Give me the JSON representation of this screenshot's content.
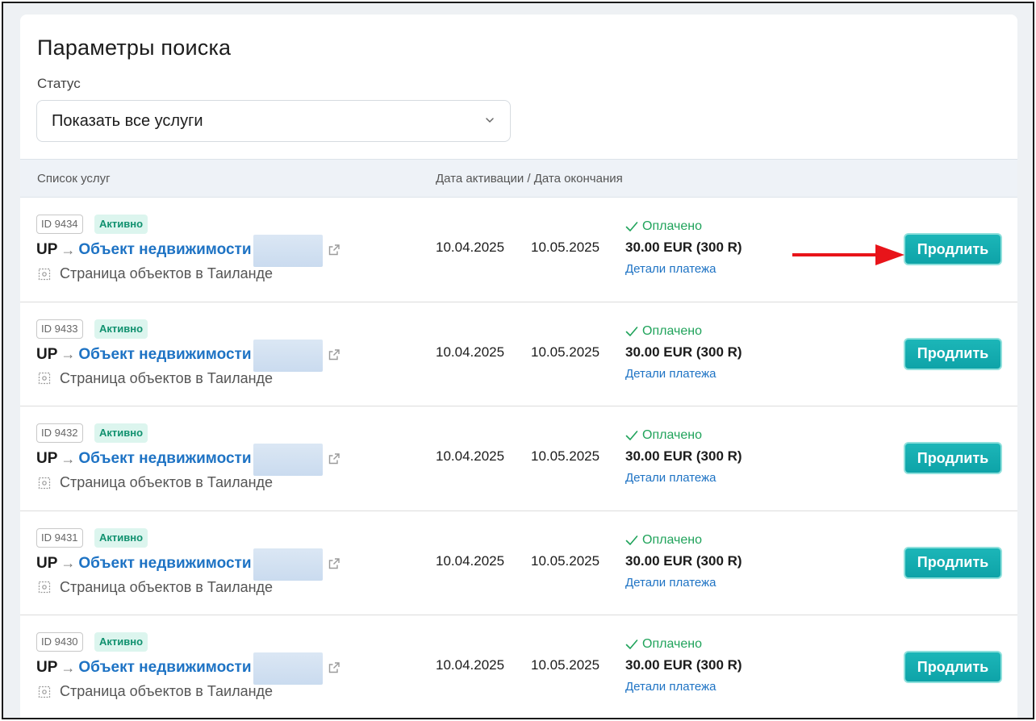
{
  "search": {
    "title": "Параметры поиска",
    "status_label": "Статус",
    "status_value": "Показать все услуги"
  },
  "table": {
    "col_services": "Список услуг",
    "col_dates": "Дата активации / Дата окончания"
  },
  "rows": [
    {
      "id": "ID 9434",
      "status": "Активно",
      "up": "UP",
      "object": "Объект недвижимости",
      "page": "Страница объектов в Таиланде",
      "start": "10.04.2025",
      "end": "10.05.2025",
      "paid": "Оплачено",
      "amount": "30.00 EUR (300 R)",
      "details": "Детали платежа",
      "button": "Продлить"
    },
    {
      "id": "ID 9433",
      "status": "Активно",
      "up": "UP",
      "object": "Объект недвижимости",
      "page": "Страница объектов в Таиланде",
      "start": "10.04.2025",
      "end": "10.05.2025",
      "paid": "Оплачено",
      "amount": "30.00 EUR (300 R)",
      "details": "Детали платежа",
      "button": "Продлить"
    },
    {
      "id": "ID 9432",
      "status": "Активно",
      "up": "UP",
      "object": "Объект недвижимости",
      "page": "Страница объектов в Таиланде",
      "start": "10.04.2025",
      "end": "10.05.2025",
      "paid": "Оплачено",
      "amount": "30.00 EUR (300 R)",
      "details": "Детали платежа",
      "button": "Продлить"
    },
    {
      "id": "ID 9431",
      "status": "Активно",
      "up": "UP",
      "object": "Объект недвижимости",
      "page": "Страница объектов в Таиланде",
      "start": "10.04.2025",
      "end": "10.05.2025",
      "paid": "Оплачено",
      "amount": "30.00 EUR (300 R)",
      "details": "Детали платежа",
      "button": "Продлить"
    },
    {
      "id": "ID 9430",
      "status": "Активно",
      "up": "UP",
      "object": "Объект недвижимости",
      "page": "Страница объектов в Таиланде",
      "start": "10.04.2025",
      "end": "10.05.2025",
      "paid": "Оплачено",
      "amount": "30.00 EUR (300 R)",
      "details": "Детали платежа",
      "button": "Продлить"
    }
  ],
  "icons": {
    "select": "chevron-down-icon",
    "external": "external-link-icon",
    "page": "page-icon",
    "paid": "check-icon",
    "annotation": "red-arrow-icon"
  },
  "colors": {
    "accent": "#1e73c4",
    "button": "#0ea3a8",
    "paid": "#20a35b",
    "active_badge": "#11916f",
    "annotation_arrow": "#e8141a"
  }
}
